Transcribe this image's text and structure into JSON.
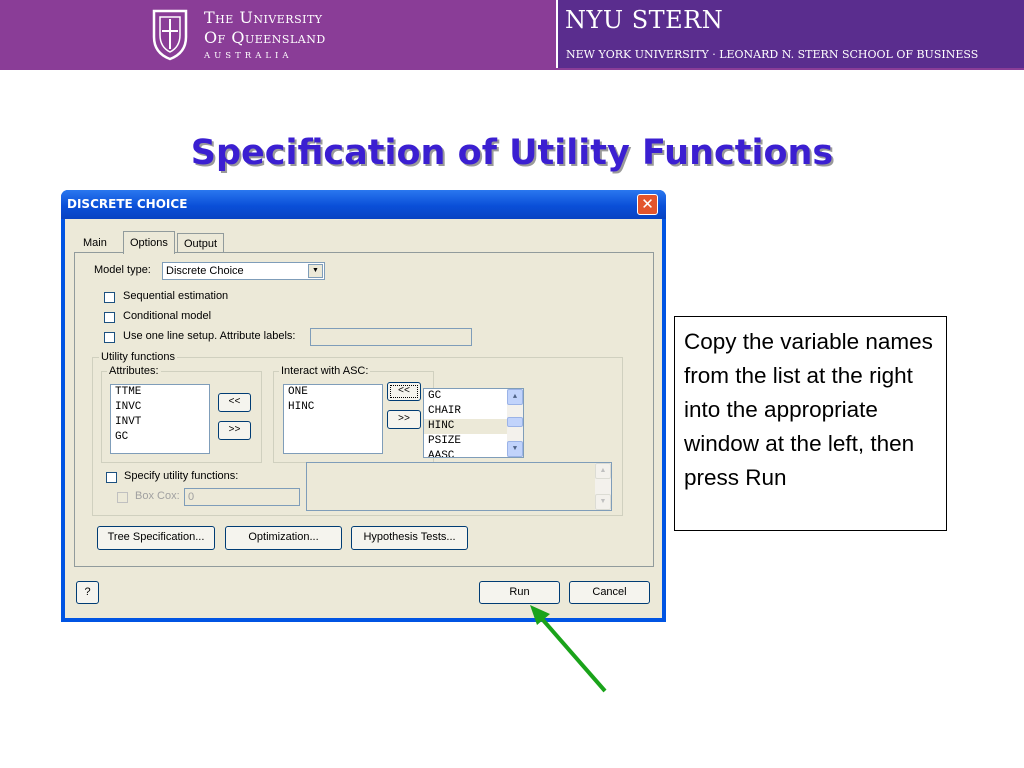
{
  "header": {
    "uq": {
      "line1": "The University",
      "line2": "Of Queensland",
      "line3": "AUSTRALIA"
    },
    "nyu": {
      "logo": "NYU STERN",
      "subtitle": "NEW YORK UNIVERSITY · LEONARD N. STERN SCHOOL OF BUSINESS"
    },
    "colors": {
      "left_bg": "#8a3d97",
      "right_bg": "#5a2d8e"
    }
  },
  "slide": {
    "title": "Specification of Utility Functions",
    "title_color": "#3b1fd1"
  },
  "dialog": {
    "title": "DISCRETE CHOICE",
    "close_label": "✕",
    "tabs": [
      {
        "label": "Main"
      },
      {
        "label": "Options",
        "active": true
      },
      {
        "label": "Output"
      }
    ],
    "model_type": {
      "label": "Model type:",
      "value": "Discrete Choice"
    },
    "checkboxes": {
      "sequential": {
        "label": "Sequential estimation",
        "checked": false
      },
      "conditional": {
        "label": "Conditional model",
        "checked": false
      },
      "one_line": {
        "label": "Use one line setup. Attribute labels:",
        "checked": false
      }
    },
    "utility_group": {
      "title": "Utility functions",
      "attributes": {
        "title": "Attributes:",
        "items": [
          "TTME",
          "INVC",
          "INVT",
          "GC"
        ]
      },
      "asc": {
        "title": "Interact with ASC:",
        "items": [
          "ONE",
          "HINC"
        ]
      },
      "move_left_label": "<<",
      "move_right_label": ">>",
      "asc_left_label": "<<",
      "asc_right_label": ">>",
      "source_list": {
        "items": [
          "GC",
          "CHAIR",
          "HINC",
          "PSIZE",
          "AASC"
        ],
        "selected": "HINC"
      },
      "specify": {
        "label": "Specify utility functions:",
        "checked": false
      },
      "box_cox": {
        "label": "Box Cox:",
        "value": "0",
        "checked": false
      }
    },
    "buttons": {
      "tree": "Tree Specification...",
      "optimization": "Optimization...",
      "hypothesis": "Hypothesis Tests...",
      "help": "?",
      "run": "Run",
      "cancel": "Cancel"
    }
  },
  "callout": {
    "text": "Copy the variable names from the list at the right into the appropriate window at the left, then press Run"
  },
  "arrow": {
    "color": "#1aa31a",
    "points_to": "Run"
  }
}
